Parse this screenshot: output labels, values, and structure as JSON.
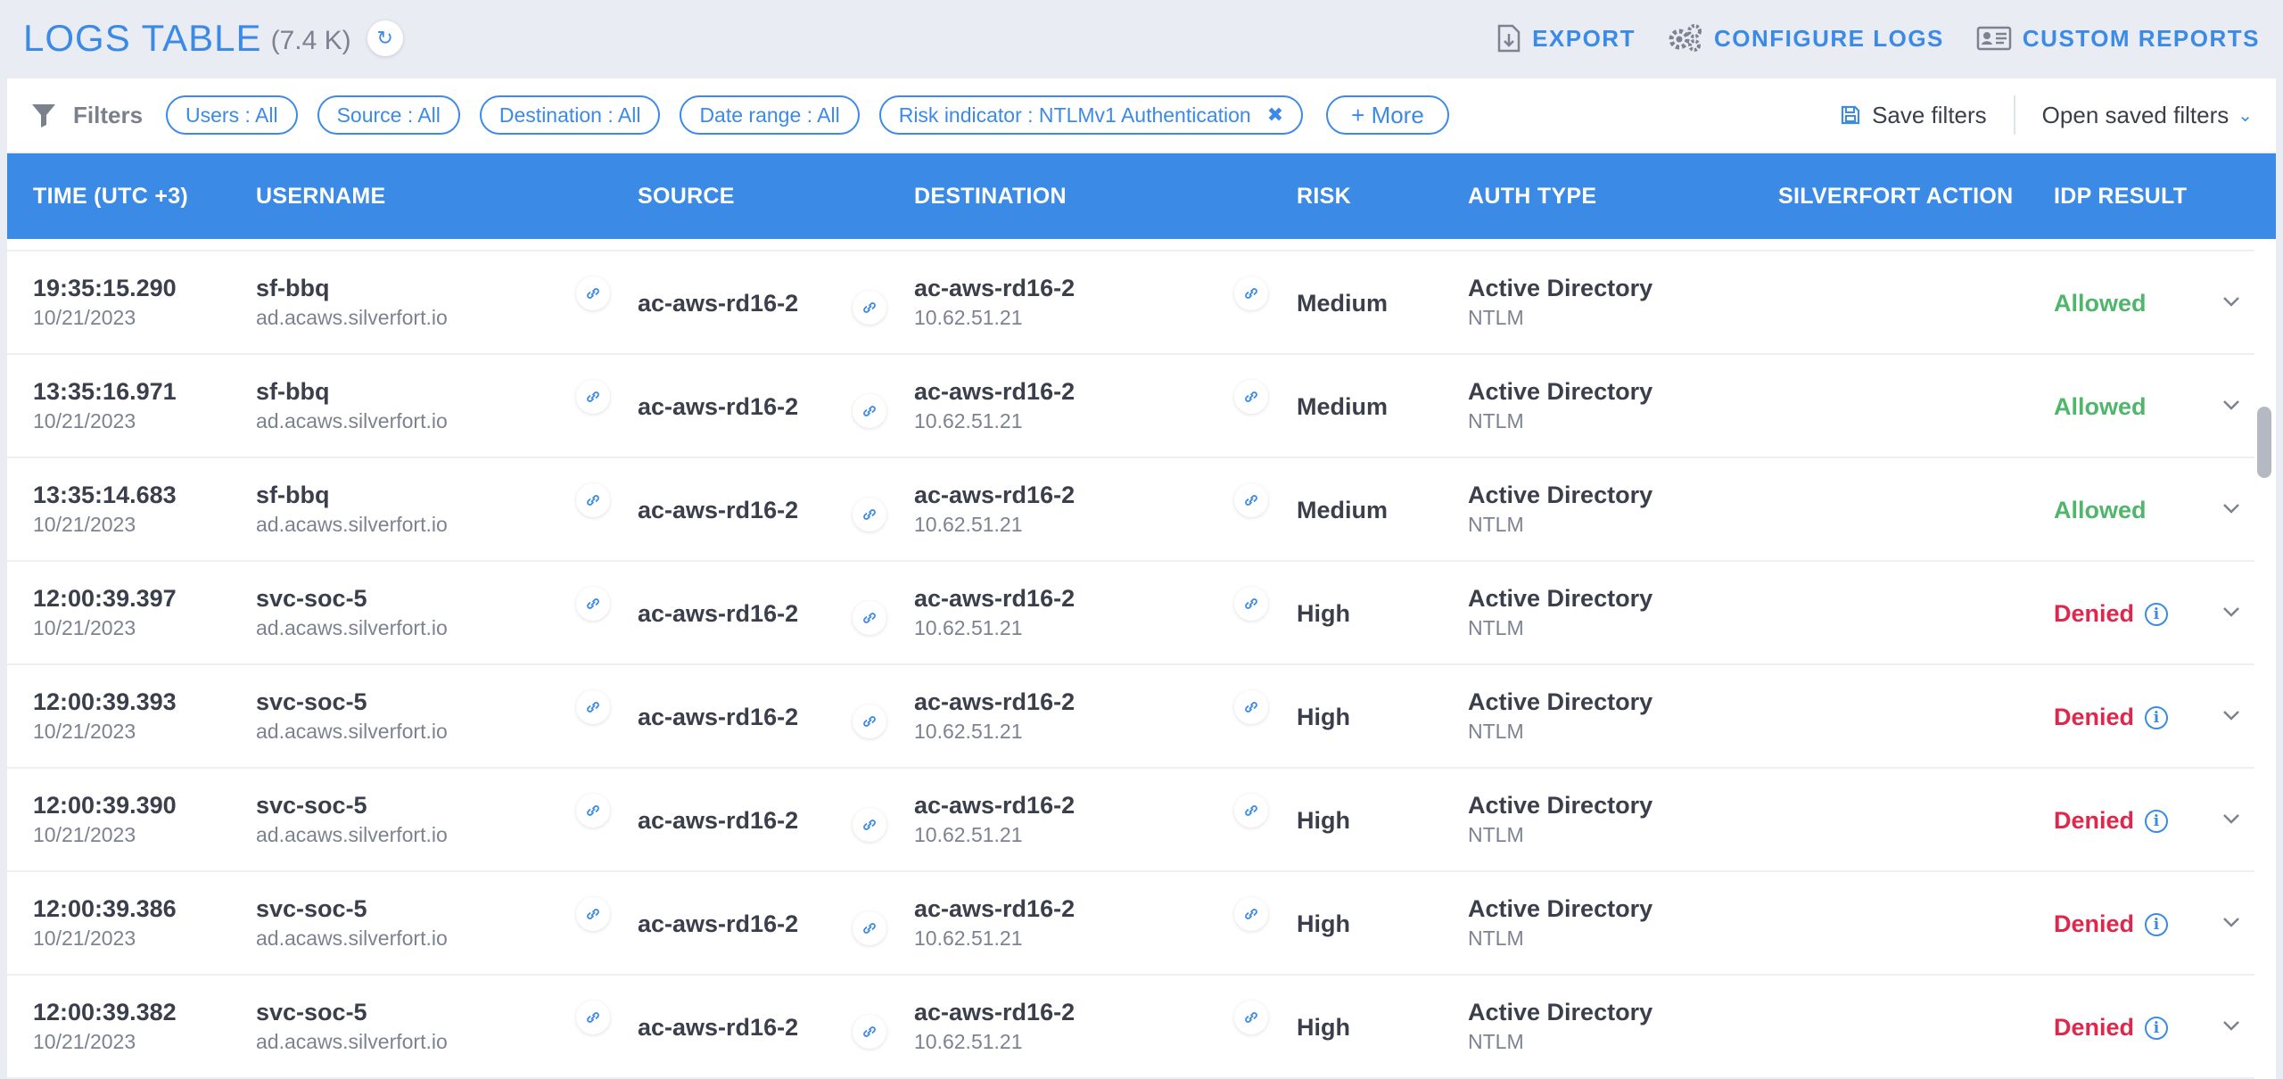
{
  "header": {
    "title": "LOGS TABLE",
    "count": "(7.4 K)",
    "actions": [
      {
        "label": "EXPORT",
        "icon": "export-icon"
      },
      {
        "label": "CONFIGURE LOGS",
        "icon": "gears-icon"
      },
      {
        "label": "CUSTOM REPORTS",
        "icon": "id-card-icon"
      }
    ]
  },
  "filters": {
    "label": "Filters",
    "chips": [
      "Users : All",
      "Source : All",
      "Destination : All",
      "Date range : All",
      "Risk indicator : NTLMv1 Authentication"
    ],
    "more_label": "+ More",
    "save_label": "Save filters",
    "open_label": "Open saved filters"
  },
  "columns": [
    "TIME (UTC +3)",
    "USERNAME",
    "SOURCE",
    "DESTINATION",
    "RISK",
    "AUTH TYPE",
    "SILVERFORT ACTION",
    "IDP RESULT"
  ],
  "colors": {
    "accent": "#3b8ae6",
    "allowed": "#4fb66b",
    "denied": "#e0264b"
  },
  "rows": [
    {
      "time": "19:35:15.290",
      "date": "10/21/2023",
      "user": "sf-bbq",
      "domain": "ad.acaws.silverfort.io",
      "source": "ac-aws-rd16-2",
      "dest": "ac-aws-rd16-2",
      "dest_ip": "10.62.51.21",
      "risk": "Medium",
      "auth": "Active Directory",
      "auth_sub": "NTLM",
      "action": "",
      "result": "Allowed"
    },
    {
      "time": "13:35:16.971",
      "date": "10/21/2023",
      "user": "sf-bbq",
      "domain": "ad.acaws.silverfort.io",
      "source": "ac-aws-rd16-2",
      "dest": "ac-aws-rd16-2",
      "dest_ip": "10.62.51.21",
      "risk": "Medium",
      "auth": "Active Directory",
      "auth_sub": "NTLM",
      "action": "",
      "result": "Allowed"
    },
    {
      "time": "13:35:14.683",
      "date": "10/21/2023",
      "user": "sf-bbq",
      "domain": "ad.acaws.silverfort.io",
      "source": "ac-aws-rd16-2",
      "dest": "ac-aws-rd16-2",
      "dest_ip": "10.62.51.21",
      "risk": "Medium",
      "auth": "Active Directory",
      "auth_sub": "NTLM",
      "action": "",
      "result": "Allowed"
    },
    {
      "time": "12:00:39.397",
      "date": "10/21/2023",
      "user": "svc-soc-5",
      "domain": "ad.acaws.silverfort.io",
      "source": "ac-aws-rd16-2",
      "dest": "ac-aws-rd16-2",
      "dest_ip": "10.62.51.21",
      "risk": "High",
      "auth": "Active Directory",
      "auth_sub": "NTLM",
      "action": "",
      "result": "Denied"
    },
    {
      "time": "12:00:39.393",
      "date": "10/21/2023",
      "user": "svc-soc-5",
      "domain": "ad.acaws.silverfort.io",
      "source": "ac-aws-rd16-2",
      "dest": "ac-aws-rd16-2",
      "dest_ip": "10.62.51.21",
      "risk": "High",
      "auth": "Active Directory",
      "auth_sub": "NTLM",
      "action": "",
      "result": "Denied"
    },
    {
      "time": "12:00:39.390",
      "date": "10/21/2023",
      "user": "svc-soc-5",
      "domain": "ad.acaws.silverfort.io",
      "source": "ac-aws-rd16-2",
      "dest": "ac-aws-rd16-2",
      "dest_ip": "10.62.51.21",
      "risk": "High",
      "auth": "Active Directory",
      "auth_sub": "NTLM",
      "action": "",
      "result": "Denied"
    },
    {
      "time": "12:00:39.386",
      "date": "10/21/2023",
      "user": "svc-soc-5",
      "domain": "ad.acaws.silverfort.io",
      "source": "ac-aws-rd16-2",
      "dest": "ac-aws-rd16-2",
      "dest_ip": "10.62.51.21",
      "risk": "High",
      "auth": "Active Directory",
      "auth_sub": "NTLM",
      "action": "",
      "result": "Denied"
    },
    {
      "time": "12:00:39.382",
      "date": "10/21/2023",
      "user": "svc-soc-5",
      "domain": "ad.acaws.silverfort.io",
      "source": "ac-aws-rd16-2",
      "dest": "ac-aws-rd16-2",
      "dest_ip": "10.62.51.21",
      "risk": "High",
      "auth": "Active Directory",
      "auth_sub": "NTLM",
      "action": "",
      "result": "Denied"
    }
  ]
}
